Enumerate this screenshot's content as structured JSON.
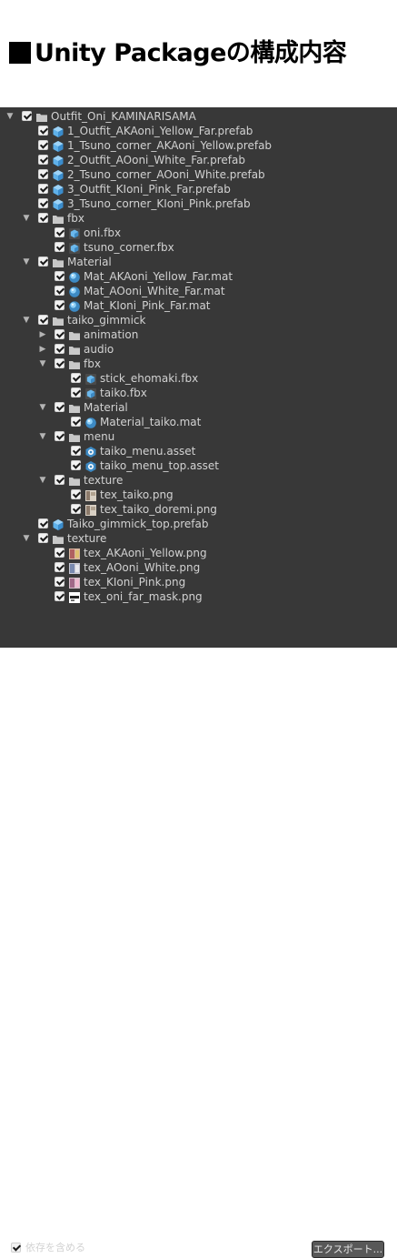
{
  "header": {
    "title": "Unity Packageの構成内容"
  },
  "tree": [
    {
      "d": 0,
      "exp": "open",
      "icon": "folder",
      "label": "Outfit_Oni_KAMINARISAMA"
    },
    {
      "d": 1,
      "exp": "",
      "icon": "prefab",
      "label": "1_Outfit_AKAoni_Yellow_Far.prefab"
    },
    {
      "d": 1,
      "exp": "",
      "icon": "prefab",
      "label": "1_Tsuno_corner_AKAoni_Yellow.prefab"
    },
    {
      "d": 1,
      "exp": "",
      "icon": "prefab",
      "label": "2_Outfit_AOoni_White_Far.prefab"
    },
    {
      "d": 1,
      "exp": "",
      "icon": "prefab",
      "label": "2_Tsuno_corner_AOoni_White.prefab"
    },
    {
      "d": 1,
      "exp": "",
      "icon": "prefab",
      "label": "3_Outfit_KIoni_Pink_Far.prefab"
    },
    {
      "d": 1,
      "exp": "",
      "icon": "prefab",
      "label": "3_Tsuno_corner_KIoni_Pink.prefab"
    },
    {
      "d": 1,
      "exp": "open",
      "icon": "folder",
      "label": "fbx"
    },
    {
      "d": 2,
      "exp": "",
      "icon": "fbx",
      "label": "oni.fbx"
    },
    {
      "d": 2,
      "exp": "",
      "icon": "fbx",
      "label": "tsuno_corner.fbx"
    },
    {
      "d": 1,
      "exp": "open",
      "icon": "folder",
      "label": "Material"
    },
    {
      "d": 2,
      "exp": "",
      "icon": "material",
      "label": "Mat_AKAoni_Yellow_Far.mat"
    },
    {
      "d": 2,
      "exp": "",
      "icon": "material",
      "label": "Mat_AOoni_White_Far.mat"
    },
    {
      "d": 2,
      "exp": "",
      "icon": "material",
      "label": "Mat_KIoni_Pink_Far.mat"
    },
    {
      "d": 1,
      "exp": "open",
      "icon": "folder",
      "label": "taiko_gimmick"
    },
    {
      "d": 2,
      "exp": "closed",
      "icon": "folder",
      "label": "animation"
    },
    {
      "d": 2,
      "exp": "closed",
      "icon": "folder",
      "label": "audio"
    },
    {
      "d": 2,
      "exp": "open",
      "icon": "folder",
      "label": "fbx"
    },
    {
      "d": 3,
      "exp": "",
      "icon": "fbx",
      "label": "stick_ehomaki.fbx"
    },
    {
      "d": 3,
      "exp": "",
      "icon": "fbx",
      "label": "taiko.fbx"
    },
    {
      "d": 2,
      "exp": "open",
      "icon": "folder",
      "label": "Material"
    },
    {
      "d": 3,
      "exp": "",
      "icon": "material",
      "label": "Material_taiko.mat"
    },
    {
      "d": 2,
      "exp": "open",
      "icon": "folder",
      "label": "menu"
    },
    {
      "d": 3,
      "exp": "",
      "icon": "asset",
      "label": "taiko_menu.asset"
    },
    {
      "d": 3,
      "exp": "",
      "icon": "asset",
      "label": "taiko_menu_top.asset"
    },
    {
      "d": 2,
      "exp": "open",
      "icon": "folder",
      "label": "texture"
    },
    {
      "d": 3,
      "exp": "",
      "icon": "tex-a",
      "label": "tex_taiko.png"
    },
    {
      "d": 3,
      "exp": "",
      "icon": "tex-a",
      "label": "tex_taiko_doremi.png"
    },
    {
      "d": 1,
      "exp": "",
      "icon": "prefab",
      "label": "Taiko_gimmick_top.prefab"
    },
    {
      "d": 1,
      "exp": "open",
      "icon": "folder",
      "label": "texture"
    },
    {
      "d": 2,
      "exp": "",
      "icon": "tex-b",
      "label": "tex_AKAoni_Yellow.png"
    },
    {
      "d": 2,
      "exp": "",
      "icon": "tex-c",
      "label": "tex_AOoni_White.png"
    },
    {
      "d": 2,
      "exp": "",
      "icon": "tex-d",
      "label": "tex_KIoni_Pink.png"
    },
    {
      "d": 2,
      "exp": "",
      "icon": "tex-e",
      "label": "tex_oni_far_mask.png"
    }
  ],
  "footer": {
    "include_deps_label": "依存を含める",
    "export_label": "エクスポート..."
  },
  "colors": {
    "panel_bg": "#383838",
    "text": "#d2d2d2",
    "prefab_blue": "#5fb1ea"
  }
}
